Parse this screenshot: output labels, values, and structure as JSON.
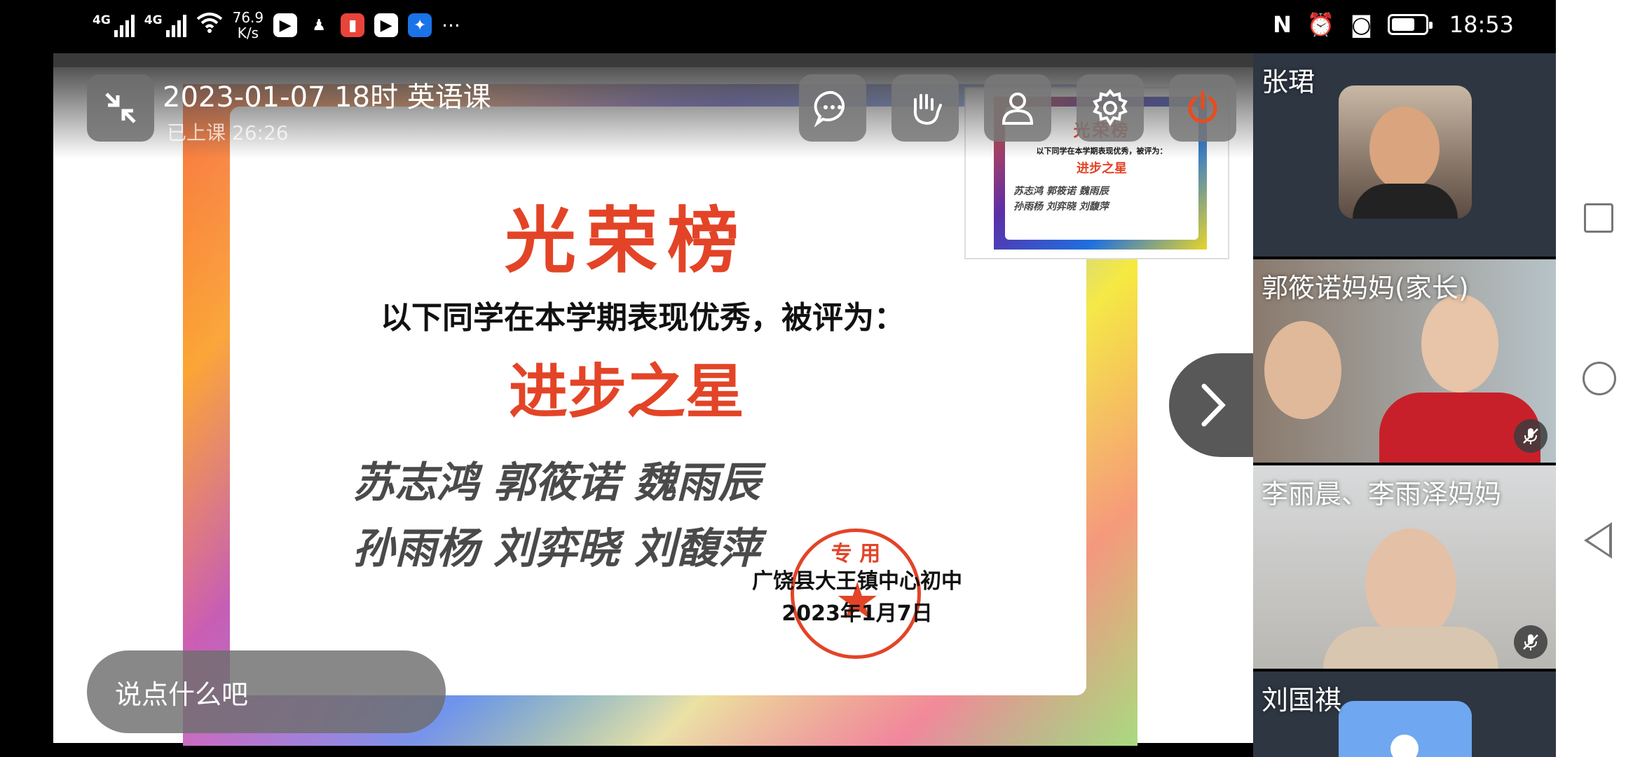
{
  "status_bar": {
    "network_1": "4G",
    "network_2": "4G",
    "speed_value": "76.9",
    "speed_unit": "K/s",
    "more": "···",
    "time": "18:53"
  },
  "meeting": {
    "title": "2023-01-07 18时 英语课",
    "elapsed": "已上课  26:26"
  },
  "slide": {
    "title": "光荣榜",
    "subtitle": "以下同学在本学期表现优秀，被评为：",
    "award": "进步之星",
    "names_line1": "苏志鸿 郭筱诺 魏雨辰",
    "names_line2": "孙雨杨 刘弈晓 刘馥萍",
    "school": "广饶县大王镇中心初中",
    "date": "2023年1月7日",
    "seal_text": "专 用"
  },
  "chat": {
    "placeholder": "说点什么吧"
  },
  "participants": [
    {
      "name": "张珺",
      "muted": false
    },
    {
      "name": "郭筱诺妈妈(家长)",
      "muted": true
    },
    {
      "name": "李丽晨、李雨泽妈妈",
      "muted": true
    },
    {
      "name": "刘国祺",
      "muted": false
    }
  ],
  "icons": {
    "shrink": "minimize-arrows-icon",
    "chat": "chat-bubble-icon",
    "hand": "raise-hand-icon",
    "person": "participants-icon",
    "settings": "gear-icon",
    "power": "power-icon",
    "next": "chevron-right-icon"
  },
  "colors": {
    "accent_red": "#e34427",
    "power_orange": "#e94c1c"
  }
}
